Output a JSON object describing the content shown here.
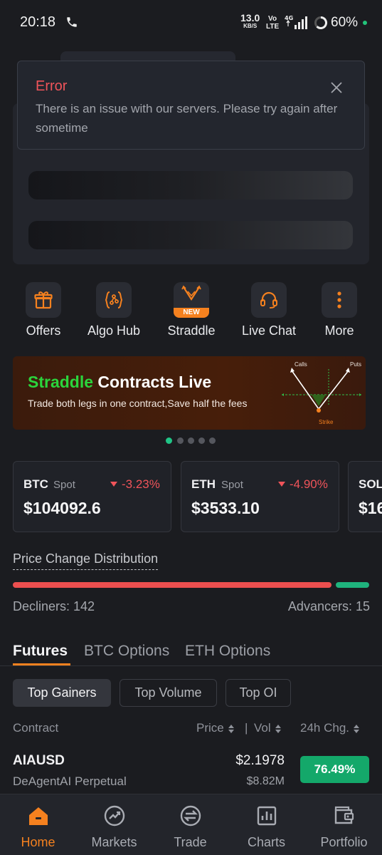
{
  "status_bar": {
    "time": "20:18",
    "net_speed": "13.0",
    "net_unit": "KB/S",
    "volte": "Vo\nLTE",
    "network": "4G",
    "battery": "60%"
  },
  "error_toast": {
    "title": "Error",
    "message": "There is an issue with our servers. Please try again after sometime"
  },
  "quick_actions": [
    {
      "label": "Offers",
      "icon": "gift-icon"
    },
    {
      "label": "Algo Hub",
      "icon": "algo-hub-icon"
    },
    {
      "label": "Straddle",
      "icon": "straddle-icon",
      "badge": "NEW"
    },
    {
      "label": "Live Chat",
      "icon": "headset-icon"
    },
    {
      "label": "More",
      "icon": "more-vertical-icon"
    }
  ],
  "banner": {
    "title_highlight": "Straddle",
    "title_rest": "Contracts Live",
    "subtitle": "Trade both legs in one contract,Save half the fees",
    "art_calls": "Calls",
    "art_puts": "Puts",
    "art_strike": "Strike"
  },
  "carousel": {
    "count": 5,
    "active": 0
  },
  "price_cards": [
    {
      "symbol": "BTC",
      "type": "Spot",
      "change": "-3.23%",
      "price": "$104092.6"
    },
    {
      "symbol": "ETH",
      "type": "Spot",
      "change": "-4.90%",
      "price": "$3533.10"
    },
    {
      "symbol": "SOL",
      "type": "",
      "change": "",
      "price": "$16"
    }
  ],
  "distribution": {
    "title": "Price Change Distribution",
    "decliners_label": "Decliners: 142",
    "advancers_label": "Advancers: 15",
    "decliners": 142,
    "advancers": 15
  },
  "market_tabs": [
    "Futures",
    "BTC Options",
    "ETH Options"
  ],
  "filter_chips": [
    "Top Gainers",
    "Top Volume",
    "Top OI"
  ],
  "table_headers": {
    "contract": "Contract",
    "price": "Price",
    "vol": "Vol",
    "separator": "|",
    "change": "24h Chg."
  },
  "rows": [
    {
      "symbol": "AIAUSD",
      "name": "DeAgentAI Perpetual",
      "price": "$2.1978",
      "volume": "$8.82M",
      "change": "76.49%"
    }
  ],
  "bottom_nav": [
    "Home",
    "Markets",
    "Trade",
    "Charts",
    "Portfolio"
  ],
  "colors": {
    "accent": "#f5811f",
    "up": "#14a86a",
    "down": "#f0545a",
    "bg": "#1b1c20"
  }
}
